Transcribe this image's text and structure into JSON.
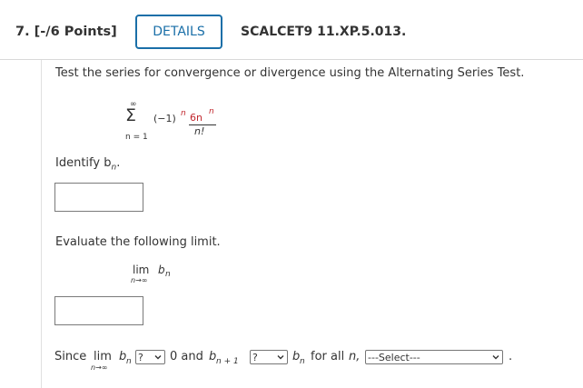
{
  "header": {
    "question_number": "7.  [-/6 Points]",
    "details_label": "DETAILS",
    "question_ref": "SCALCET9 11.XP.5.013."
  },
  "prompt": "Test the series for convergence or divergence using the Alternating Series Test.",
  "series": {
    "sum_upper": "∞",
    "sum_symbol": "Σ",
    "sum_lower": "n = 1",
    "sign_term": "(−1)",
    "sign_exp": "n",
    "numerator_coef": "6n",
    "numerator_exp": "n",
    "denominator": "n!"
  },
  "identify_label": "Identify b",
  "identify_sub": "n",
  "identify_end": ".",
  "identify_answer": "",
  "limit_instruction": "Evaluate the following limit.",
  "limit_expr": {
    "lim": "lim",
    "under": "n→∞",
    "b": "b",
    "sub": "n"
  },
  "limit_answer": "",
  "since_line": {
    "since": "Since",
    "lim": "lim",
    "under": "n→∞",
    "b": "b",
    "sub": "n",
    "select1": "?",
    "zero_and": "0 and",
    "b2": "b",
    "sub2": "n + 1",
    "select2": "?",
    "b3": "b",
    "sub3": "n",
    "for_all": "for all",
    "n_var": "n,",
    "select3": "---Select---",
    "period": "."
  }
}
